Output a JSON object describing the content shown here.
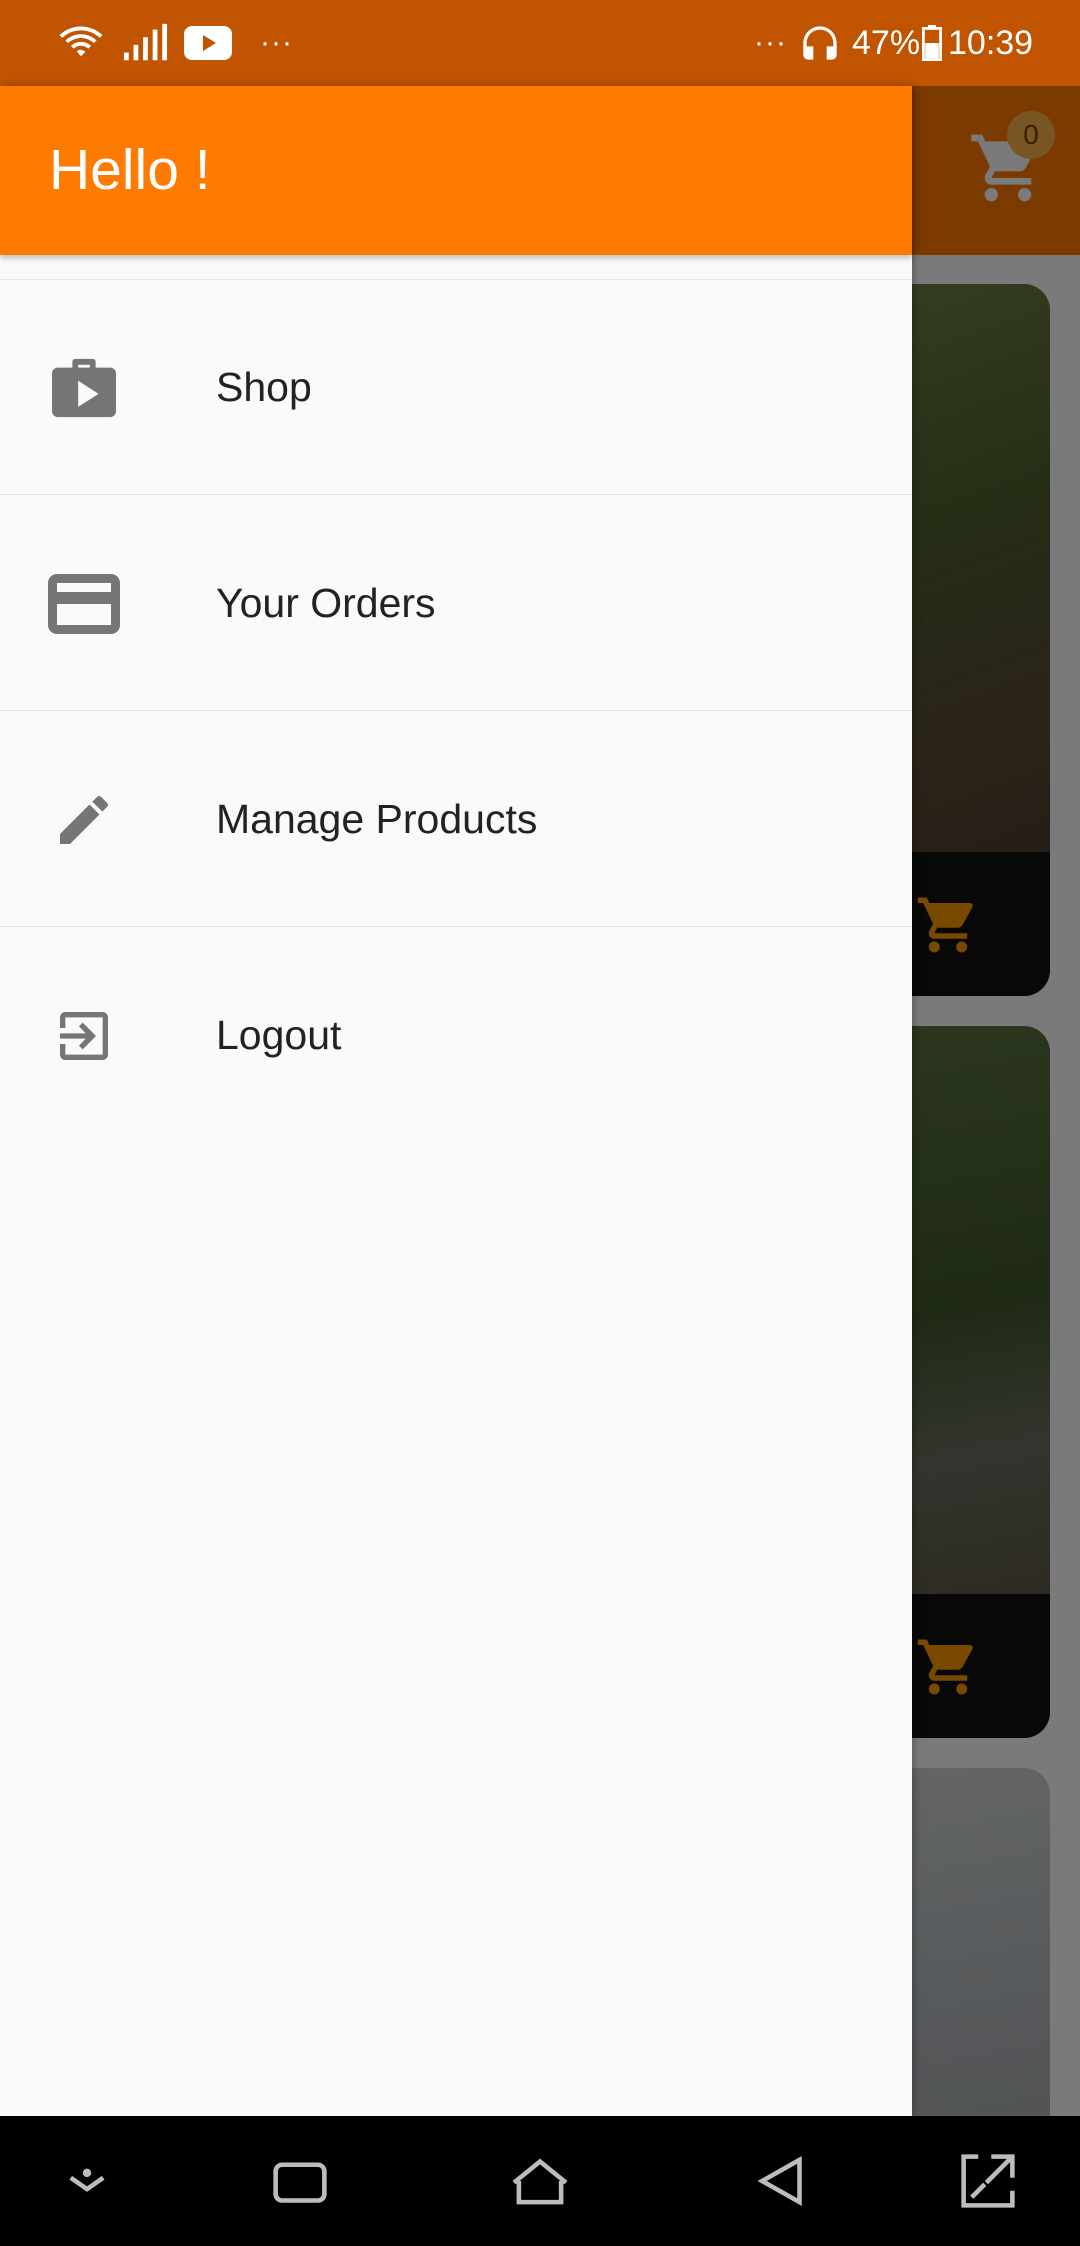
{
  "status_bar": {
    "battery_percent": "47%",
    "time": "10:39",
    "left_overflow": "···",
    "right_overflow": "···",
    "icons": [
      "wifi-icon",
      "signal-icon",
      "youtube-icon",
      "headphones-icon",
      "battery-icon"
    ]
  },
  "app_bar": {
    "cart_count": "0",
    "icons": [
      "cart-icon"
    ]
  },
  "drawer": {
    "title": "Hello !",
    "items": [
      {
        "label": "Shop",
        "icon": "shop-bag-icon"
      },
      {
        "label": "Your Orders",
        "icon": "credit-card-icon"
      },
      {
        "label": "Manage Products",
        "icon": "edit-pencil-icon"
      },
      {
        "label": "Logout",
        "icon": "logout-icon"
      }
    ]
  },
  "products": {
    "icons": [
      "add-to-cart-icon"
    ]
  },
  "colors": {
    "primary": "#ff7a00",
    "status_bar": "#c05400",
    "accent_cart": "#ff9800",
    "drawer_bg": "#fafafa",
    "icon_gray": "#757575"
  },
  "nav_bar": {
    "buttons": [
      "expand-down-icon",
      "recents-icon",
      "home-icon",
      "back-icon",
      "screenshot-expand-icon"
    ]
  }
}
